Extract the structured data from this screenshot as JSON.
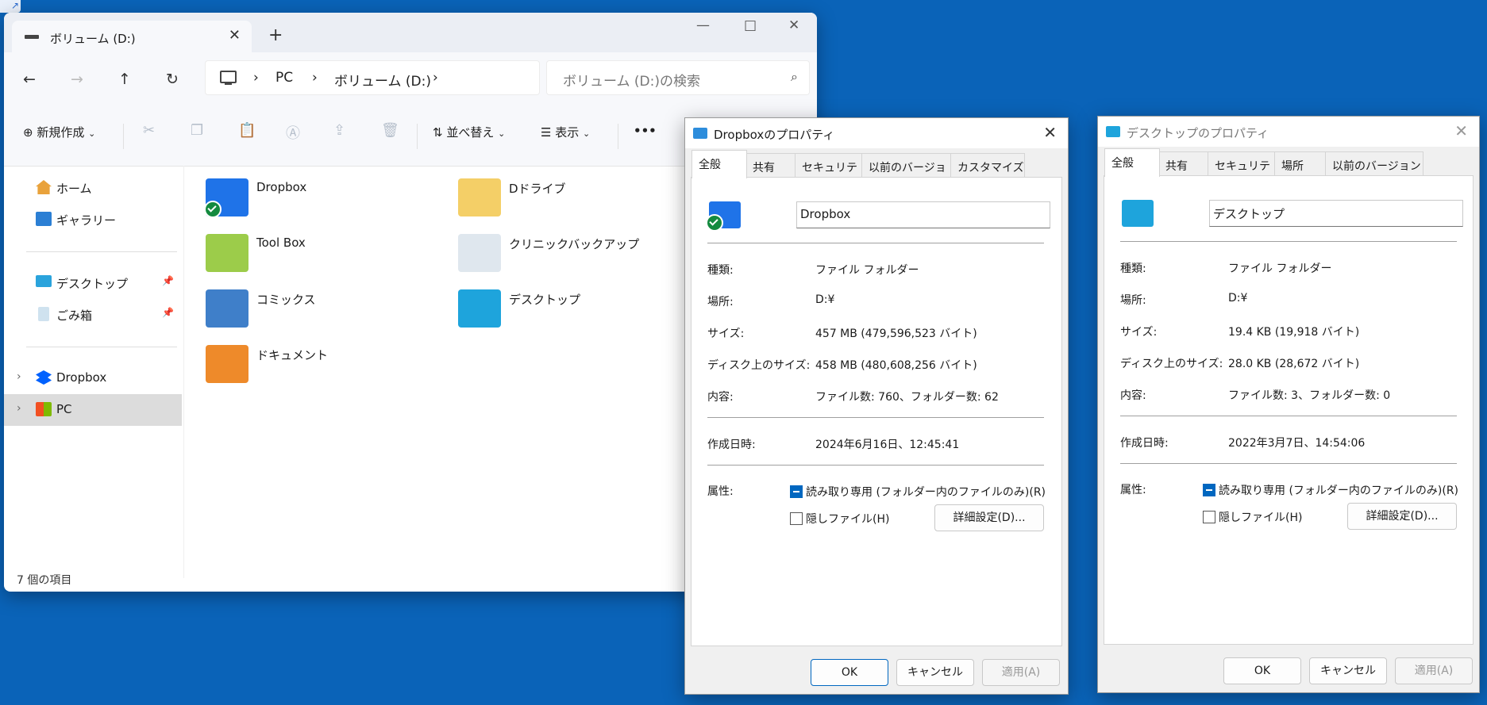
{
  "colors": {
    "desktop": "#0a63b8",
    "accent": "#0067c0",
    "sync": "#148a3f"
  },
  "explorer": {
    "tab_title": "ボリューム (D:)",
    "new_tab": "+",
    "window_controls": {
      "minimize": "—",
      "maximize": "□",
      "close": "✕"
    },
    "nav": {
      "back": "←",
      "forward": "→",
      "up": "↑",
      "refresh": "↻"
    },
    "breadcrumb": [
      "PC",
      "ボリューム (D:)"
    ],
    "search_placeholder": "ボリューム (D:)の検索",
    "toolbar": {
      "new": "新規作成",
      "sort": "並べ替え",
      "view": "表示",
      "more": "•••"
    },
    "sidebar": {
      "home": "ホーム",
      "gallery": "ギャラリー",
      "desktop": "デスクトップ",
      "recycle": "ごみ箱",
      "dropbox": "Dropbox",
      "pc": "PC"
    },
    "files": [
      "Dropbox",
      "Dドライブ",
      "Tool Box",
      "クリニックバックアップ",
      "コミックス",
      "デスクトップ",
      "ドキュメント"
    ],
    "status": "7 個の項目"
  },
  "dlg1": {
    "title": "Dropboxのプロパティ",
    "tabs": [
      "全般",
      "共有",
      "セキュリティ",
      "以前のバージョン",
      "カスタマイズ"
    ],
    "name": "Dropbox",
    "labels": {
      "type": "種類:",
      "location": "場所:",
      "size": "サイズ:",
      "disk_size": "ディスク上のサイズ:",
      "contents": "内容:",
      "created": "作成日時:",
      "attrs": "属性:"
    },
    "values": {
      "type": "ファイル フォルダー",
      "location": "D:¥",
      "size": "457 MB (479,596,523 バイト)",
      "disk_size": "458 MB (480,608,256 バイト)",
      "contents": "ファイル数: 760、フォルダー数: 62",
      "created": "2024年6月16日、12:45:41"
    },
    "readonly": "読み取り専用 (フォルダー内のファイルのみ)(R)",
    "hidden": "隠しファイル(H)",
    "advanced": "詳細設定(D)...",
    "ok": "OK",
    "cancel": "キャンセル",
    "apply": "適用(A)"
  },
  "dlg2": {
    "title": "デスクトップのプロパティ",
    "tabs": [
      "全般",
      "共有",
      "セキュリティ",
      "場所",
      "以前のバージョン"
    ],
    "name": "デスクトップ",
    "labels": {
      "type": "種類:",
      "location": "場所:",
      "size": "サイズ:",
      "disk_size": "ディスク上のサイズ:",
      "contents": "内容:",
      "created": "作成日時:",
      "attrs": "属性:"
    },
    "values": {
      "type": "ファイル フォルダー",
      "location": "D:¥",
      "size": "19.4 KB (19,918 バイト)",
      "disk_size": "28.0 KB (28,672 バイト)",
      "contents": "ファイル数: 3、フォルダー数: 0",
      "created": "2022年3月7日、14:54:06"
    },
    "readonly": "読み取り専用 (フォルダー内のファイルのみ)(R)",
    "hidden": "隠しファイル(H)",
    "advanced": "詳細設定(D)...",
    "ok": "OK",
    "cancel": "キャンセル",
    "apply": "適用(A)"
  }
}
